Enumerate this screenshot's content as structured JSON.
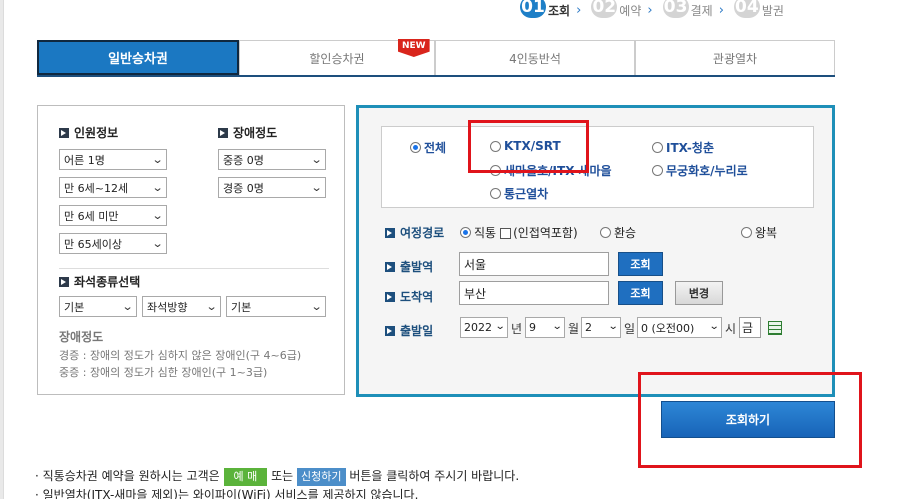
{
  "steps": [
    {
      "num": "01",
      "label": "조회",
      "active": true
    },
    {
      "num": "02",
      "label": "예약",
      "active": false
    },
    {
      "num": "03",
      "label": "결제",
      "active": false
    },
    {
      "num": "04",
      "label": "발권",
      "active": false
    }
  ],
  "tabs": [
    {
      "label": "일반승차권"
    },
    {
      "label": "할인승차권",
      "badge": "NEW"
    },
    {
      "label": "4인동반석"
    },
    {
      "label": "관광열차"
    }
  ],
  "passengers": {
    "title": "인원정보",
    "adult": "어른 1명",
    "child": "만 6세~12세",
    "infant": "만 6세 미만",
    "senior": "만 65세이상"
  },
  "disability": {
    "title": "장애정도",
    "severe": "중증 0명",
    "mild": "경증 0명"
  },
  "seat": {
    "title": "좌석종류선택",
    "type": "기본",
    "direction": "좌석방향",
    "option": "기본"
  },
  "disability_info": {
    "heading": "장애정도",
    "mild_desc": "경증 : 장애의 정도가 심하지 않은 장애인(구 4~6급)",
    "severe_desc": "중증 : 장애의 정도가 심한 장애인(구 1~3급)"
  },
  "train_types": {
    "all": "전체",
    "ktx": "KTX/SRT",
    "itx_cheongchun": "ITX-청춘",
    "saemaeul": "새마을호/ITX-새마을",
    "mugunghwa": "무궁화호/누리로",
    "commuter": "통근열차"
  },
  "route": {
    "label": "여정경로",
    "direct": "직통",
    "nearby": "(인접역포함)",
    "transfer": "환승",
    "round_trip": "왕복"
  },
  "departure": {
    "label": "출발역",
    "value": "서울",
    "button": "조회"
  },
  "arrival": {
    "label": "도착역",
    "value": "부산",
    "button": "조회",
    "swap": "변경"
  },
  "date": {
    "label": "출발일",
    "year": "2022",
    "year_unit": "년",
    "month": "9",
    "month_unit": "월",
    "day": "2",
    "day_unit": "일",
    "hour": "0 (오전00)",
    "hour_unit": "시",
    "weekday": "금"
  },
  "search_button": "조회하기",
  "notes": {
    "line1_pre": "· 직통승차권 예약을 원하시는 고객은",
    "line1_tag1": "예 매",
    "line1_mid": "또는",
    "line1_tag2": "신청하기",
    "line1_post": "버튼을 클릭하여 주시기 바랍니다.",
    "line2": "· 일반열차(ITX-새마을 제외)는 와이파이(WiFi) 서비스를 제공하지 않습니다."
  },
  "colors": {
    "accent": "#1b78c2",
    "panel_border": "#1e8fb8",
    "highlight": "#e0141b"
  }
}
